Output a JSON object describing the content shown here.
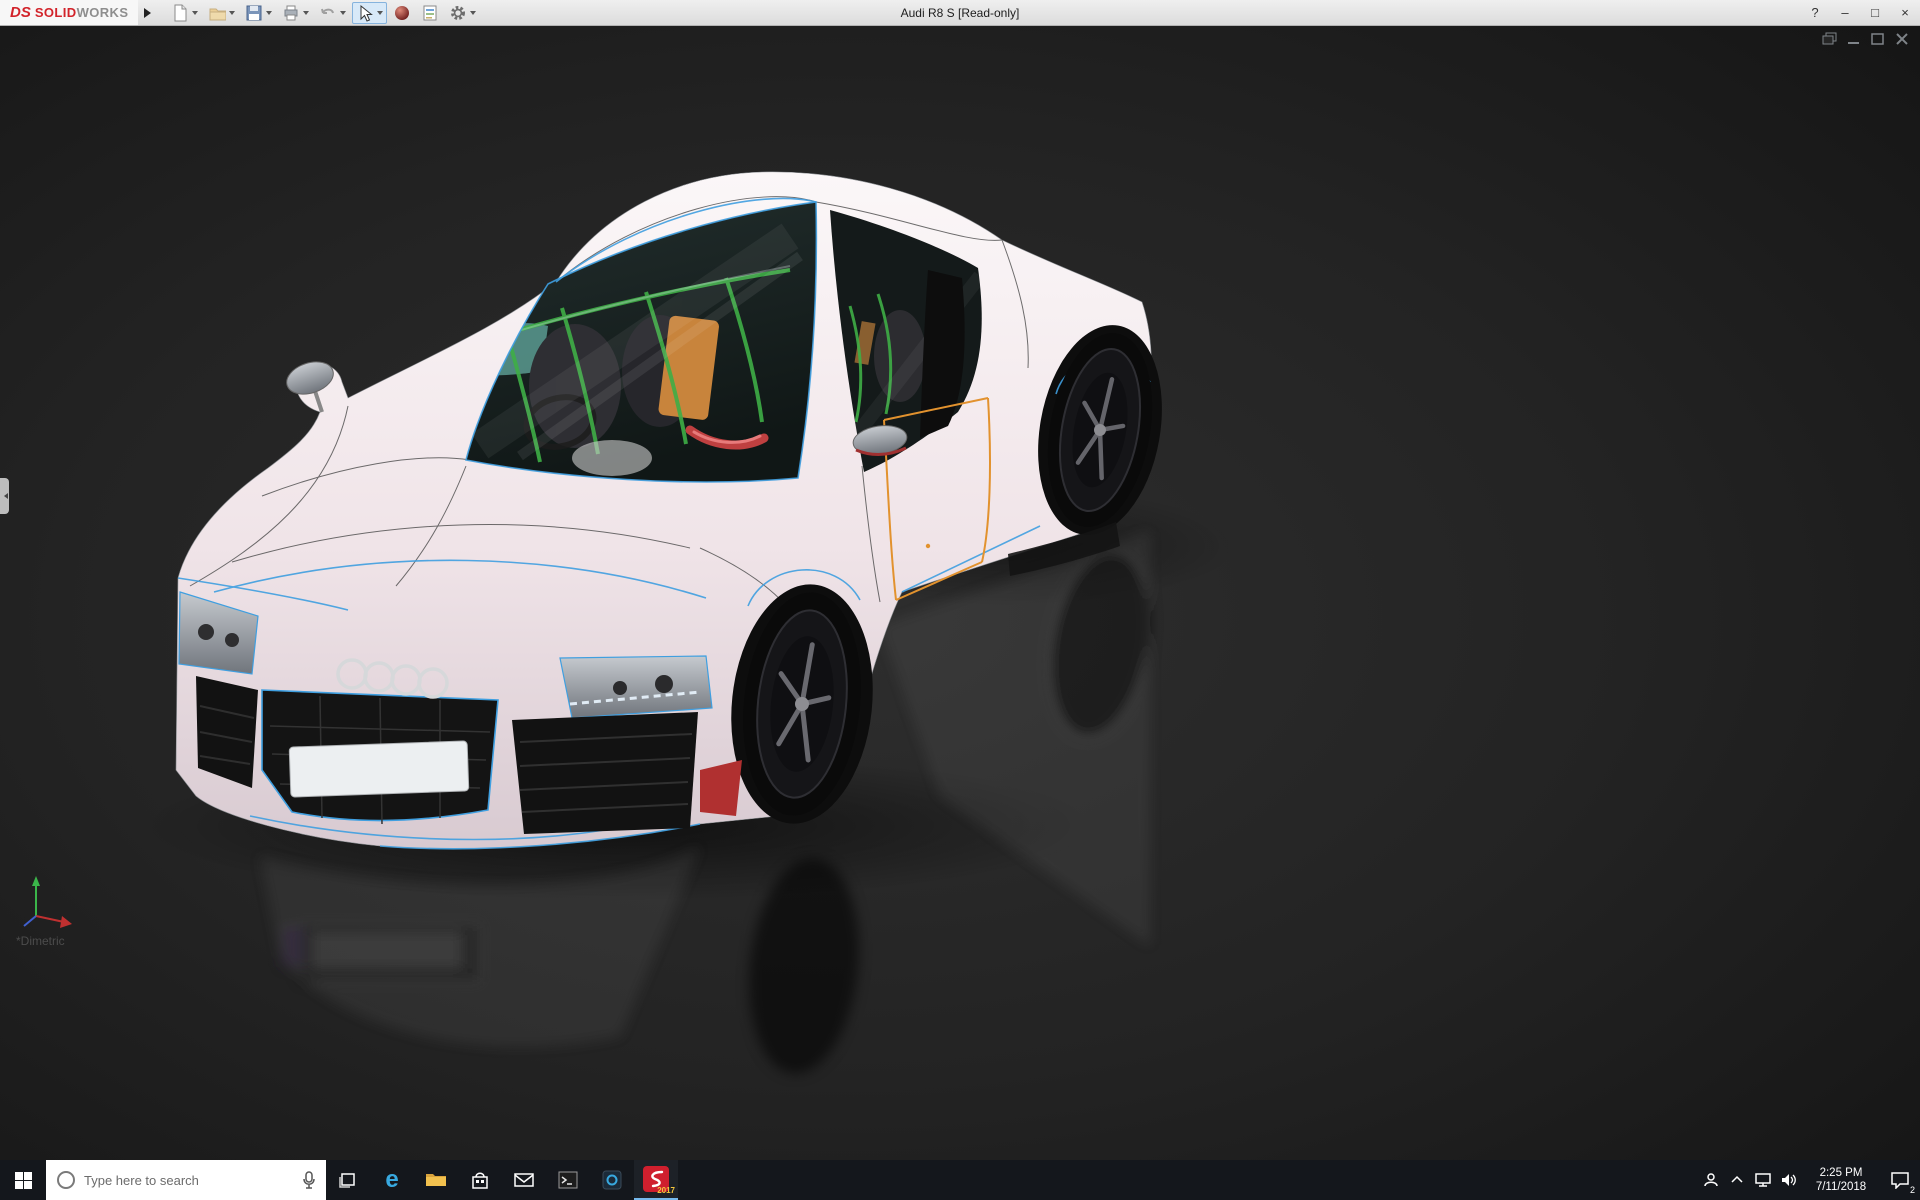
{
  "title_bar": {
    "brand_ds": "DS",
    "brand_solid": "SOLID",
    "brand_works": "WORKS",
    "document_title": "Audi R8 S [Read-only]",
    "help_glyph": "?",
    "window_controls": {
      "minimize": "–",
      "maximize": "□",
      "close": "×"
    },
    "toolbar_icons": [
      "new-document",
      "open",
      "save",
      "print",
      "undo",
      "select",
      "appearances",
      "file-properties",
      "options"
    ]
  },
  "viewport": {
    "view_label": "*Dimetric",
    "child_window_controls": [
      "restore",
      "minimize",
      "maximize",
      "close"
    ],
    "colors": {
      "background": "#1f1f1f",
      "edge_highlight": "#3f9fe0",
      "door_outline": "#e2922e",
      "body": "#f3ebee",
      "interior_cage": "#3fae46"
    }
  },
  "taskbar": {
    "search_placeholder": "Type here to search",
    "edge_glyph": "e",
    "solidworks_badge": "2017",
    "clock": {
      "time": "2:25 PM",
      "date": "7/11/2018"
    },
    "notification_badge": "2",
    "icons": [
      "start",
      "cortana-circle",
      "search-mic",
      "task-view",
      "edge",
      "file-explorer",
      "store",
      "mail",
      "command-prompt",
      "media-app",
      "solidworks",
      "people",
      "hidden-icons-chevron",
      "network",
      "volume",
      "action-center"
    ]
  }
}
